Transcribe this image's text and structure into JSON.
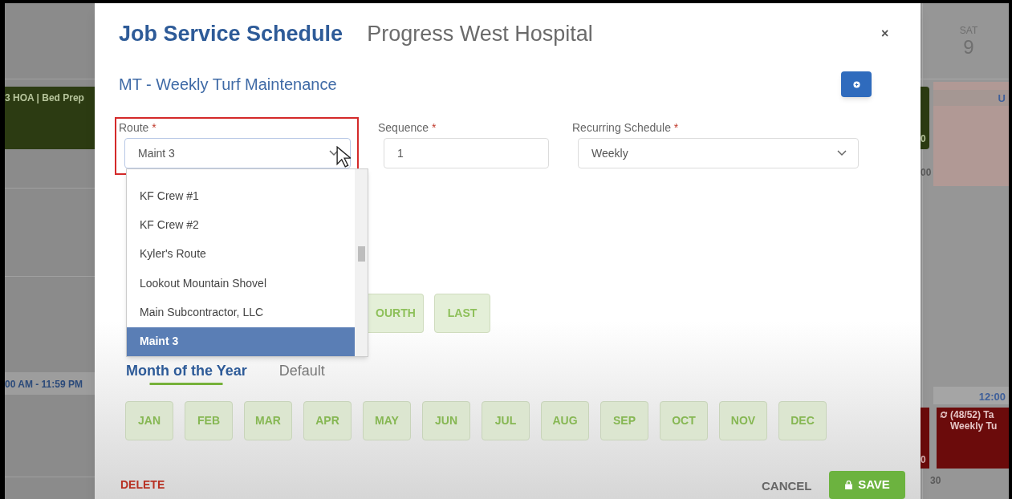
{
  "calendar_left": {
    "event": "3 HOA | Bed Prep",
    "time_bar": "00 AM - 11:59 PM"
  },
  "calendar_right": {
    "day": "SAT",
    "date": "9",
    "event_1_time": "0",
    "time_1": "00",
    "event_2_label": "U",
    "time_bar": "12:00",
    "event_3_time": "0",
    "event_4_lines": [
      "(48/52) Ta",
      "Weekly Tu"
    ],
    "time_2": "30"
  },
  "modal": {
    "title": "Job Service Schedule",
    "location": "Progress West Hospital",
    "close": "×",
    "subtitle": "MT - Weekly Turf Maintenance",
    "fields": [
      {
        "kind": "select",
        "label": "Route",
        "required_mark": "*",
        "value": "Maint 3",
        "highlighted": true
      },
      {
        "kind": "input",
        "label": "Sequence",
        "required_mark": "*",
        "value": "1",
        "highlighted": false
      },
      {
        "kind": "select",
        "label": "Recurring Schedule",
        "required_mark": "*",
        "value": "Weekly",
        "highlighted": false
      }
    ],
    "route_options": [
      {
        "label": "KF Crew #1",
        "selected": false
      },
      {
        "label": "KF Crew #2",
        "selected": false
      },
      {
        "label": "Kyler's Route",
        "selected": false
      },
      {
        "label": "Lookout Mountain Shovel",
        "selected": false
      },
      {
        "label": "Main Subcontractor, LLC",
        "selected": false
      },
      {
        "label": "Maint 3",
        "selected": true
      }
    ],
    "week_buttons": [
      "OURTH",
      "LAST"
    ],
    "tabs": [
      {
        "label": "Month of the Year",
        "selected": true
      },
      {
        "label": "Default",
        "selected": false
      }
    ],
    "months": [
      "JAN",
      "FEB",
      "MAR",
      "APR",
      "MAY",
      "JUN",
      "JUL",
      "AUG",
      "SEP",
      "OCT",
      "NOV",
      "DEC"
    ],
    "delete": "DELETE",
    "cancel": "CANCEL",
    "save": "SAVE"
  }
}
